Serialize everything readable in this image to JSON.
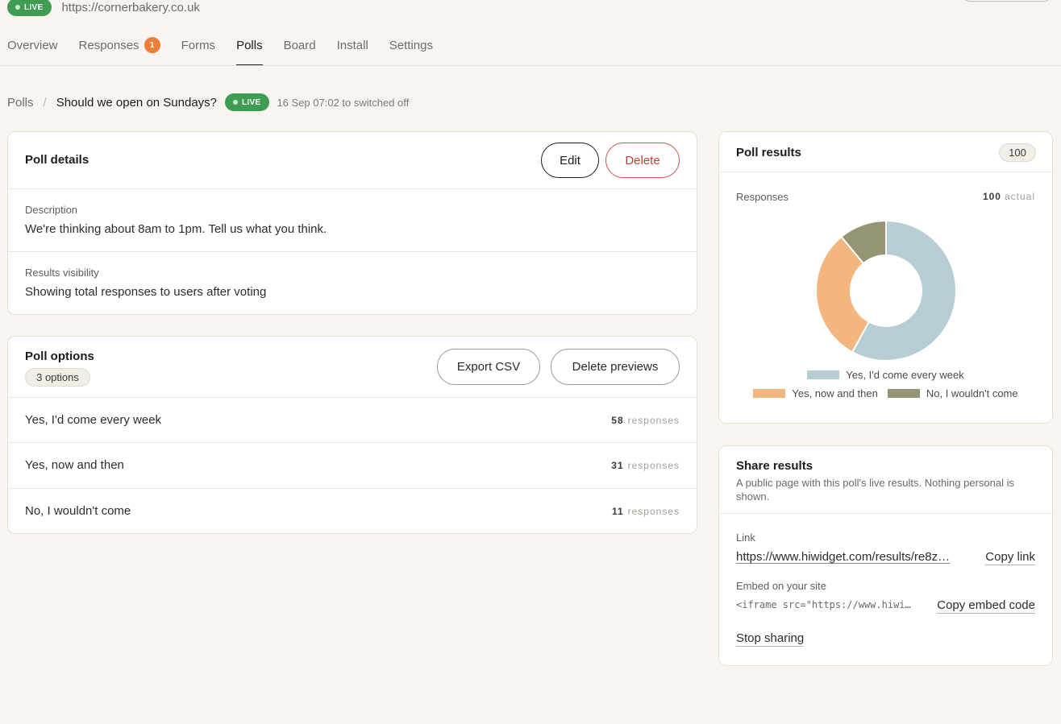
{
  "site": {
    "status": "LIVE",
    "url": "https://cornerbakery.co.uk"
  },
  "tabs": [
    {
      "label": "Overview"
    },
    {
      "label": "Responses",
      "badge": "1"
    },
    {
      "label": "Forms"
    },
    {
      "label": "Polls",
      "active": true
    },
    {
      "label": "Board"
    },
    {
      "label": "Install"
    },
    {
      "label": "Settings"
    }
  ],
  "breadcrumb": {
    "parent": "Polls",
    "separator": "/",
    "title": "Should we open on Sundays?",
    "status": "LIVE",
    "meta": "16 Sep 07:02 to switched off"
  },
  "poll_details": {
    "title": "Poll details",
    "edit_label": "Edit",
    "delete_label": "Delete",
    "description_label": "Description",
    "description": "We're thinking about 8am to 1pm. Tell us what you think.",
    "visibility_label": "Results visibility",
    "visibility": "Showing total responses to users after voting"
  },
  "poll_options": {
    "title": "Poll options",
    "count_chip": "3 options",
    "export_label": "Export CSV",
    "delete_previews_label": "Delete previews",
    "responses_word": "responses",
    "options": [
      {
        "label": "Yes, I'd come every week",
        "count": "58"
      },
      {
        "label": "Yes, now and then",
        "count": "31"
      },
      {
        "label": "No, I wouldn't come",
        "count": "11"
      }
    ]
  },
  "poll_results": {
    "title": "Poll results",
    "total_badge": "100",
    "responses_label": "Responses",
    "total": "100",
    "total_suffix": "actual"
  },
  "chart_data": {
    "type": "pie",
    "donut": true,
    "categories": [
      "Yes, I'd come every week",
      "Yes, now and then",
      "No, I wouldn't come"
    ],
    "values": [
      58,
      31,
      11
    ],
    "colors": [
      "#b7cdd4",
      "#f3b67e",
      "#959574"
    ],
    "legend_position": "bottom"
  },
  "share": {
    "title": "Share results",
    "subtitle": "A public page with this poll's live results. Nothing personal is shown.",
    "link_label": "Link",
    "link_url": "https://www.hiwidget.com/results/re8z…",
    "copy_link_label": "Copy link",
    "embed_label": "Embed on your site",
    "embed_code": "<iframe src=\"https://www.hiwi…",
    "copy_embed_label": "Copy embed code",
    "stop_label": "Stop sharing"
  }
}
